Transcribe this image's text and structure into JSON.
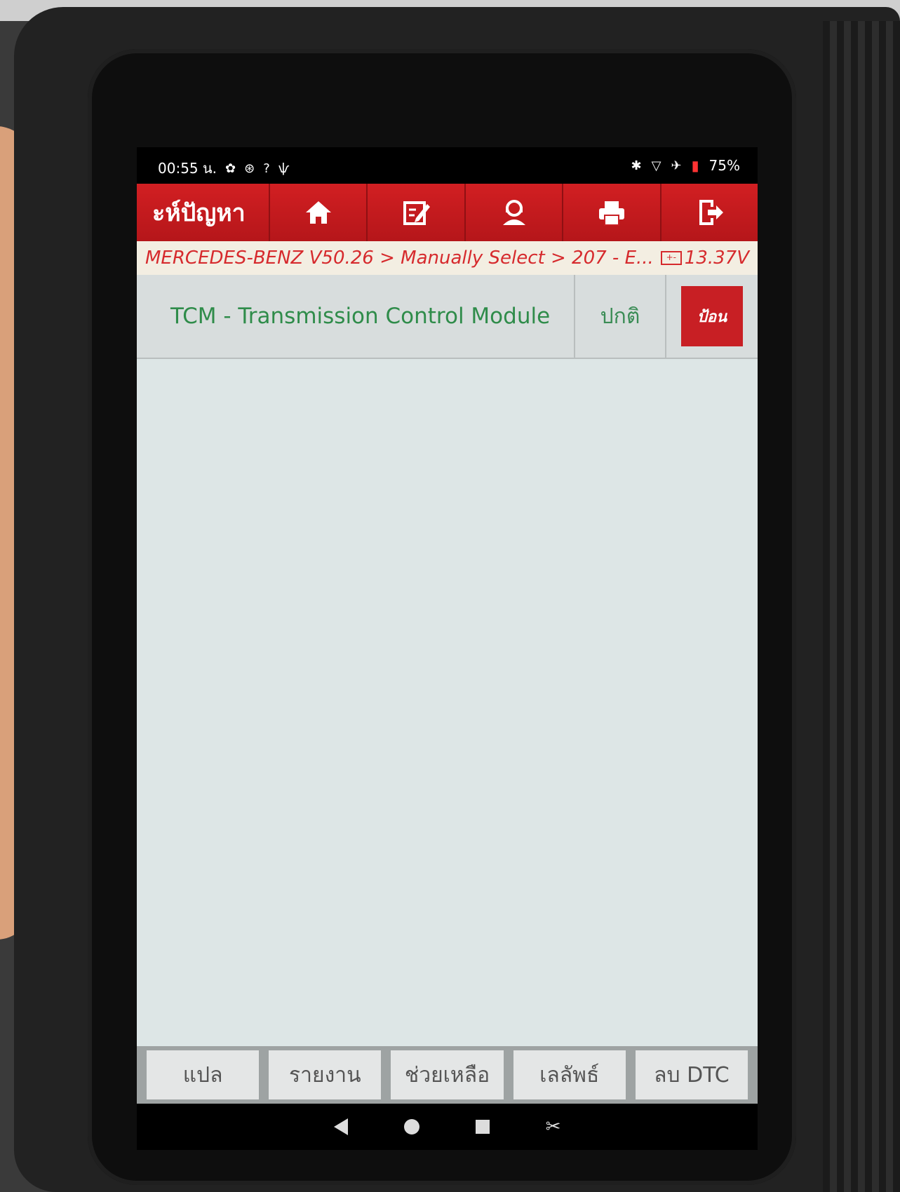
{
  "status_bar": {
    "time": "00:55 น.",
    "battery_percent": "75%"
  },
  "toolbar": {
    "title": "ะห์ปัญหา",
    "buttons": [
      {
        "icon": "home-icon"
      },
      {
        "icon": "edit-icon"
      },
      {
        "icon": "support-icon"
      },
      {
        "icon": "printer-icon"
      },
      {
        "icon": "exit-icon"
      }
    ]
  },
  "breadcrumb": {
    "path": "MERCEDES-BENZ V50.26 > Manually Select > 207 - E...",
    "voltage": "13.37V"
  },
  "modules": [
    {
      "name": "TCM - Transmission Control Module",
      "status": "ปกติ",
      "action": "ป้อน"
    }
  ],
  "bottom_buttons": [
    "แปล",
    "รายงาน",
    "ช่วยเหลือ",
    "เลลัพธ์",
    "ลบ DTC"
  ],
  "colors": {
    "toolbar_red": "#c81f24",
    "module_text_green": "#2f8c4a",
    "content_bg": "#dde6e6"
  }
}
